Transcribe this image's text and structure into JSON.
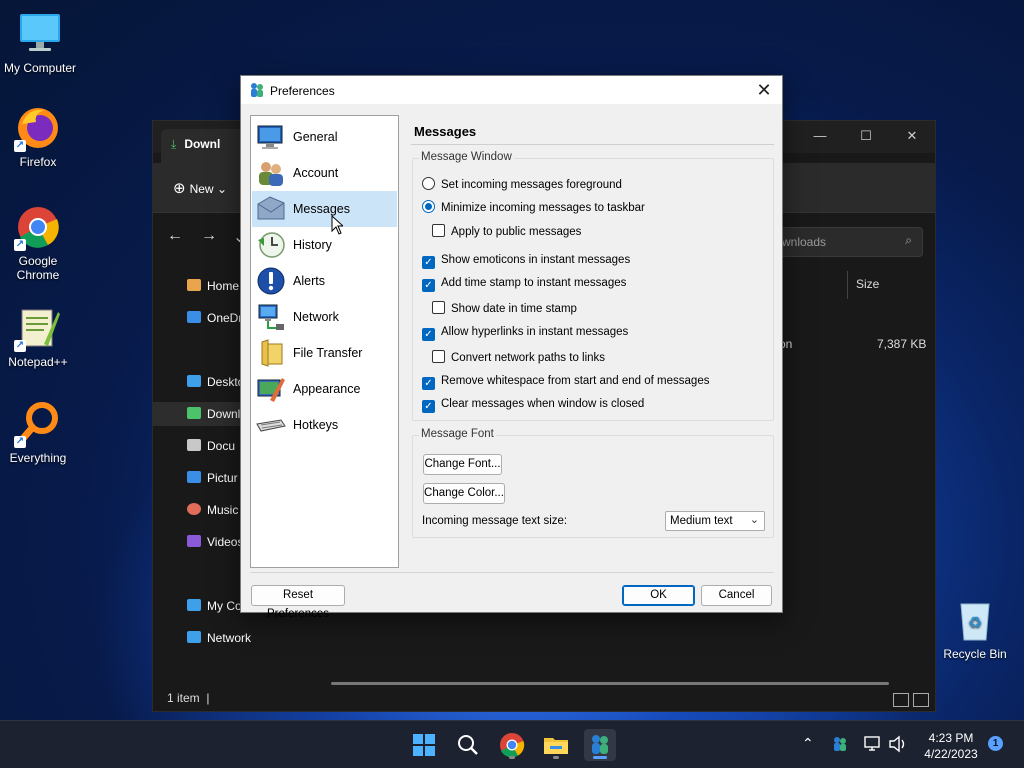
{
  "desktop": {
    "icons": [
      {
        "label": "My Computer"
      },
      {
        "label": "Firefox"
      },
      {
        "label": "Google Chrome"
      },
      {
        "label": "Notepad++"
      },
      {
        "label": "Everything"
      },
      {
        "label": "Recycle Bin"
      }
    ]
  },
  "explorer": {
    "tab_title": "Downl",
    "new_label": "New",
    "search_placeholder": "wnloads",
    "sidebar": [
      "Home",
      "OneDr",
      "Deskto",
      "Downl",
      "Docu",
      "Pictur",
      "Music",
      "Videos",
      "My Co",
      "Network"
    ],
    "column_size": "Size",
    "row_type": "on",
    "row_size": "7,387 KB",
    "status": "1 item"
  },
  "dialog": {
    "title": "Preferences",
    "nav": [
      {
        "label": "General",
        "icon": "general-monitor-icon"
      },
      {
        "label": "Account",
        "icon": "account-users-icon"
      },
      {
        "label": "Messages",
        "icon": "messages-envelope-icon"
      },
      {
        "label": "History",
        "icon": "history-clock-icon"
      },
      {
        "label": "Alerts",
        "icon": "alerts-exclamation-icon"
      },
      {
        "label": "Network",
        "icon": "network-computer-icon"
      },
      {
        "label": "File Transfer",
        "icon": "file-transfer-folder-icon"
      },
      {
        "label": "Appearance",
        "icon": "appearance-palette-icon"
      },
      {
        "label": "Hotkeys",
        "icon": "hotkeys-keyboard-icon"
      }
    ],
    "selected_nav": "Messages",
    "section_title": "Messages",
    "message_window": {
      "group_title": "Message Window",
      "options": [
        {
          "label": "Set incoming messages foreground",
          "type": "radio",
          "checked": false
        },
        {
          "label": "Minimize incoming messages to taskbar",
          "type": "radio",
          "checked": true
        },
        {
          "label": "Apply to public messages",
          "type": "checkbox",
          "checked": false
        },
        {
          "label": "Show emoticons in instant messages",
          "type": "checkbox",
          "checked": true
        },
        {
          "label": "Add time stamp to instant messages",
          "type": "checkbox",
          "checked": true
        },
        {
          "label": "Show date in time stamp",
          "type": "checkbox",
          "checked": false
        },
        {
          "label": "Allow hyperlinks in instant messages",
          "type": "checkbox",
          "checked": true
        },
        {
          "label": "Convert network paths to links",
          "type": "checkbox",
          "checked": false
        },
        {
          "label": "Remove whitespace from start and end of messages",
          "type": "checkbox",
          "checked": true
        },
        {
          "label": "Clear messages when window is closed",
          "type": "checkbox",
          "checked": true
        }
      ]
    },
    "message_font": {
      "group_title": "Message Font",
      "change_font": "Change Font...",
      "change_color": "Change Color...",
      "text_size_label": "Incoming message text size:",
      "text_size_value": "Medium text"
    },
    "reset_button": "Reset Preferences",
    "ok_button": "OK",
    "cancel_button": "Cancel"
  },
  "taskbar": {
    "time": "4:23 PM",
    "date": "4/22/2023",
    "notification_count": "1"
  },
  "colors": {
    "accent": "#0067c0",
    "nav_selected": "#cce4f7",
    "taskbar": "#1c2230"
  }
}
